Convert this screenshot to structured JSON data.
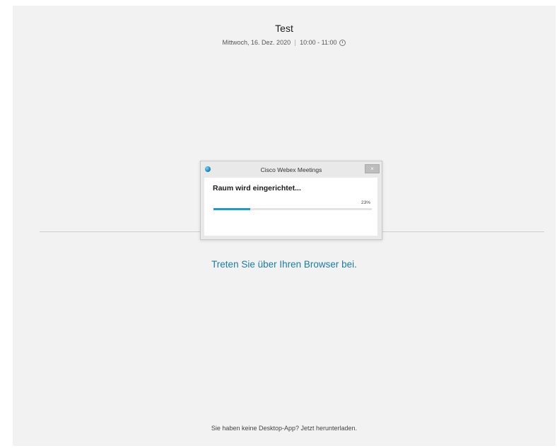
{
  "meeting": {
    "title": "Test",
    "date": "Mittwoch, 16. Dez. 2020",
    "time": "10:00 - 11:00"
  },
  "dialog": {
    "title": "Cisco Webex Meetings",
    "close_label": "×",
    "status": "Raum wird eingerichtet...",
    "progress_label": "23%",
    "progress_value": 0.23
  },
  "join_browser_link": "Treten Sie über Ihren Browser bei.",
  "download_prompt": "Sie haben keine Desktop-App? Jetzt herunterladen.",
  "colors": {
    "link": "#1a7da6",
    "progress": "#1e9bd0",
    "background": "#f2f2f2"
  },
  "icons": {
    "time": "clock-icon",
    "app": "webex-logo-icon"
  }
}
